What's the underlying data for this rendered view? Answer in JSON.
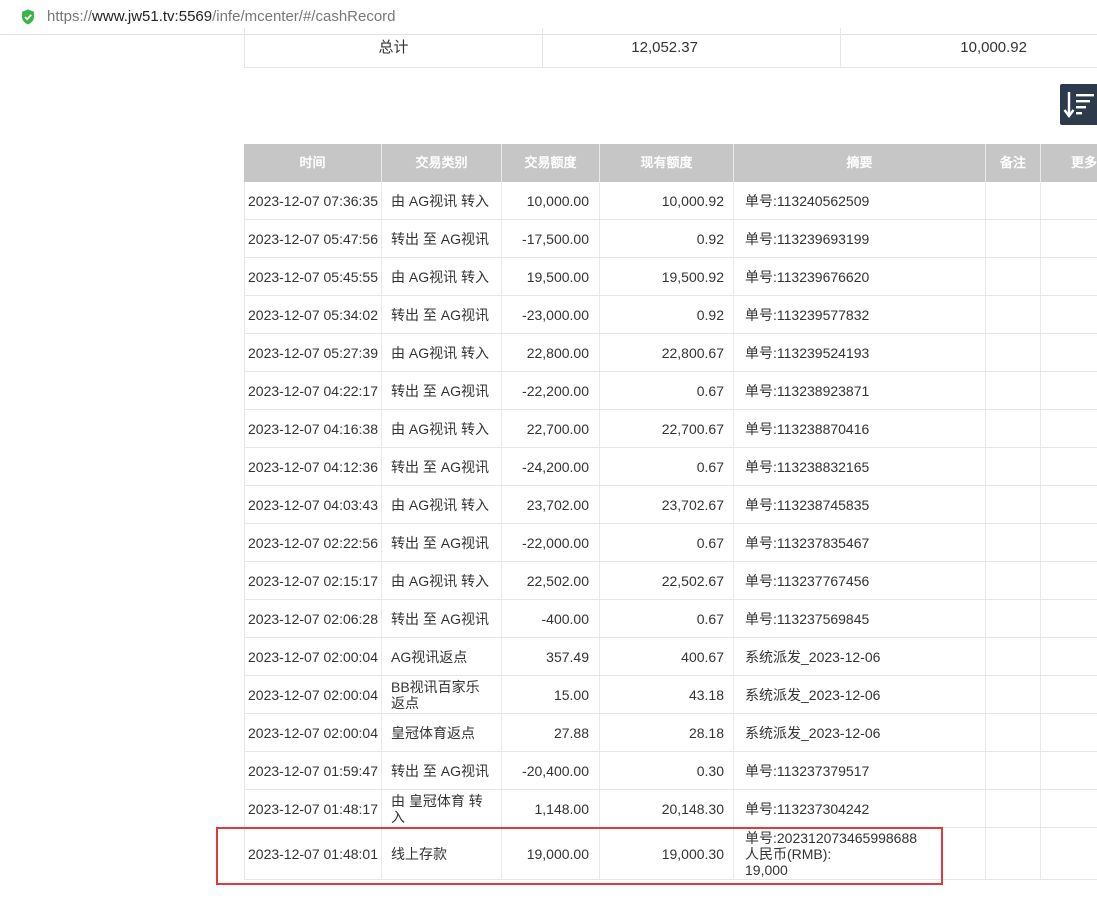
{
  "browser": {
    "url_prefix": "https://",
    "url_domain": "www.jw51.tv:5569",
    "url_path": "/infe/mcenter/#/cashRecord"
  },
  "summary": {
    "label": "总计",
    "total_amount": "12,052.37",
    "total_balance": "10,000.92"
  },
  "table": {
    "headers": [
      "时间",
      "交易类别",
      "交易额度",
      "现有额度",
      "摘要",
      "备注",
      "更多"
    ],
    "rows": [
      {
        "time": "2023-12-07 07:36:35",
        "type": "由 AG视讯 转入",
        "amount": "10,000.00",
        "balance": "10,000.92",
        "summary": "单号:113240562509"
      },
      {
        "time": "2023-12-07 05:47:56",
        "type": "转出 至 AG视讯",
        "amount": "-17,500.00",
        "balance": "0.92",
        "summary": "单号:113239693199"
      },
      {
        "time": "2023-12-07 05:45:55",
        "type": "由 AG视讯 转入",
        "amount": "19,500.00",
        "balance": "19,500.92",
        "summary": "单号:113239676620"
      },
      {
        "time": "2023-12-07 05:34:02",
        "type": "转出 至 AG视讯",
        "amount": "-23,000.00",
        "balance": "0.92",
        "summary": "单号:113239577832"
      },
      {
        "time": "2023-12-07 05:27:39",
        "type": "由 AG视讯 转入",
        "amount": "22,800.00",
        "balance": "22,800.67",
        "summary": "单号:113239524193"
      },
      {
        "time": "2023-12-07 04:22:17",
        "type": "转出 至 AG视讯",
        "amount": "-22,200.00",
        "balance": "0.67",
        "summary": "单号:113238923871"
      },
      {
        "time": "2023-12-07 04:16:38",
        "type": "由 AG视讯 转入",
        "amount": "22,700.00",
        "balance": "22,700.67",
        "summary": "单号:113238870416"
      },
      {
        "time": "2023-12-07 04:12:36",
        "type": "转出 至 AG视讯",
        "amount": "-24,200.00",
        "balance": "0.67",
        "summary": "单号:113238832165"
      },
      {
        "time": "2023-12-07 04:03:43",
        "type": "由 AG视讯 转入",
        "amount": "23,702.00",
        "balance": "23,702.67",
        "summary": "单号:113238745835"
      },
      {
        "time": "2023-12-07 02:22:56",
        "type": "转出 至 AG视讯",
        "amount": "-22,000.00",
        "balance": "0.67",
        "summary": "单号:113237835467"
      },
      {
        "time": "2023-12-07 02:15:17",
        "type": "由 AG视讯 转入",
        "amount": "22,502.00",
        "balance": "22,502.67",
        "summary": "单号:113237767456"
      },
      {
        "time": "2023-12-07 02:06:28",
        "type": "转出 至 AG视讯",
        "amount": "-400.00",
        "balance": "0.67",
        "summary": "单号:113237569845"
      },
      {
        "time": "2023-12-07 02:00:04",
        "type": "AG视讯返点",
        "amount": "357.49",
        "balance": "400.67",
        "summary": "系统派发_2023-12-06"
      },
      {
        "time": "2023-12-07 02:00:04",
        "type": "BB视讯百家乐返点",
        "amount": "15.00",
        "balance": "43.18",
        "summary": "系统派发_2023-12-06"
      },
      {
        "time": "2023-12-07 02:00:04",
        "type": "皇冠体育返点",
        "amount": "27.88",
        "balance": "28.18",
        "summary": "系统派发_2023-12-06"
      },
      {
        "time": "2023-12-07 01:59:47",
        "type": "转出 至 AG视讯",
        "amount": "-20,400.00",
        "balance": "0.30",
        "summary": "单号:113237379517"
      },
      {
        "time": "2023-12-07 01:48:17",
        "type": "由 皇冠体育 转入",
        "amount": "1,148.00",
        "balance": "20,148.30",
        "summary": "单号:113237304242"
      }
    ],
    "last_row": {
      "time": "2023-12-07 01:48:01",
      "type": "线上存款",
      "amount": "19,000.00",
      "balance": "19,000.30",
      "summary_line1": "单号:202312073465998688",
      "summary_line2": "人民币(RMB):",
      "summary_line3": "19,000"
    }
  },
  "icons": {
    "secure": "shield-check-icon",
    "sort": "sort-descending-icon"
  },
  "colors": {
    "header_bg": "#c6c6c6",
    "sort_button_bg": "#2d3a4b",
    "highlight_border": "#e0393e",
    "secure_green": "#3bb54a"
  }
}
